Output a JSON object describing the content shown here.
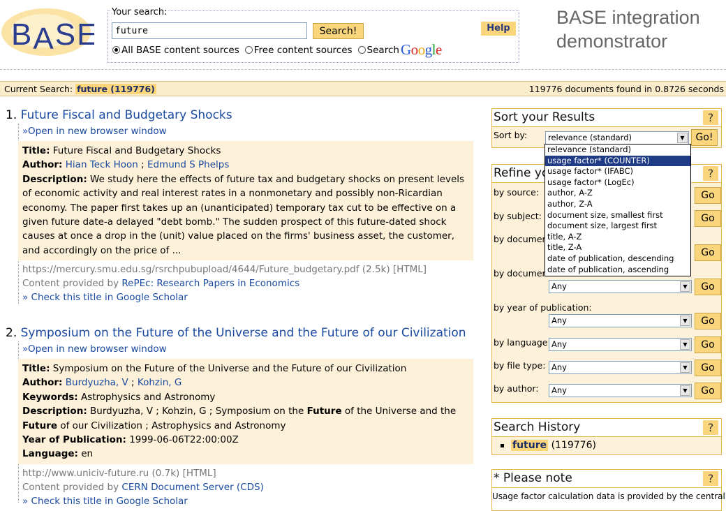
{
  "header": {
    "logo_text": "BASE",
    "search_label": "Your search:",
    "query": "future",
    "search_button": "Search!",
    "help_button": "Help",
    "radio_options": [
      {
        "label": "All BASE content sources",
        "selected": true
      },
      {
        "label": "Free content sources",
        "selected": false
      },
      {
        "label": "Search",
        "selected": false
      }
    ],
    "google_logo": "Google",
    "demo_title_line1": "BASE integration",
    "demo_title_line2": "demonstrator"
  },
  "status": {
    "current_label": "Current Search:",
    "current_query": "future (119776)",
    "summary": "119776 documents found in 0.8726 seconds"
  },
  "results": [
    {
      "number": "1.",
      "title": "Future Fiscal and Budgetary Shocks",
      "open_link": "»Open in new browser window",
      "title_label": "Title:",
      "title_value": "Future Fiscal and Budgetary Shocks",
      "author_label": "Author:",
      "authors": [
        "Hian Teck Hoon",
        "Edmund S Phelps"
      ],
      "description_label": "Description:",
      "description": "We study here the effects of future tax and budgetary shocks on present levels of economic activity and real interest rates in a nonmonetary and possibly non-Ricardian economy. The paper first takes up an (unanticipated) temporary tax cut to be effective on a given future date-a delayed \"debt bomb.\" The sudden prospect of this future-dated shock causes at once a drop in the (unit) value placed on the firms' business asset, the customer, and accordingly on the price of ...",
      "url": "https://mercury.smu.edu.sg/rsrchpubupload/4644/Future_budgetary.pdf (2.5k) [HTML]",
      "provided_label": "Content provided by",
      "provider": "RePEc: Research Papers in Economics",
      "scholar": "» Check this title in Google Scholar"
    },
    {
      "number": "2.",
      "title": "Symposium on the Future of the Universe and the Future of our Civilization",
      "open_link": "»Open in new browser window",
      "title_label": "Title:",
      "title_value": "Symposium on the Future of the Universe and the Future of our Civilization",
      "author_label": "Author:",
      "authors": [
        "Burdyuzha, V",
        "Kohzin, G"
      ],
      "keywords_label": "Keywords:",
      "keywords": "Astrophysics and Astronomy",
      "description_label": "Description:",
      "desc_parts": [
        "Burdyuzha, V ; Kohzin, G ; Symposium on the ",
        "Future",
        " of the Universe and the ",
        "Future",
        " of our Civilization ; Astrophysics and Astronomy"
      ],
      "year_label": "Year of Publication:",
      "year": "1999-06-06T22:00:00Z",
      "language_label": "Language:",
      "language": "en",
      "url": "http://www.uniciv-future.ru (0.7k) [HTML]",
      "provided_label": "Content provided by",
      "provider": "CERN Document Server (CDS)",
      "scholar": "» Check this title in Google Scholar"
    }
  ],
  "sort_panel": {
    "title": "Sort your Results",
    "help": "?",
    "sort_by_label": "Sort by:",
    "selected": "relevance (standard)",
    "go": "Go!",
    "options": [
      "relevance (standard)",
      "usage factor* (COUNTER)",
      "usage factor* (IFABC)",
      "usage factor* (LogEc)",
      "author, A-Z",
      "author, Z-A",
      "document size, smallest first",
      "document size, largest first",
      "title, A-Z",
      "title, Z-A",
      "date of publication, descending",
      "date of publication, ascending"
    ],
    "highlighted_index": 1
  },
  "refine_panel": {
    "title": "Refine yo",
    "help": "?",
    "rows": [
      {
        "label": "by source:",
        "value": "",
        "go": "Go"
      },
      {
        "label": "by subject:",
        "value": "",
        "go": "Go"
      },
      {
        "label": "by documen",
        "value": "",
        "go": "Go"
      },
      {
        "label": "by documen",
        "value": "Any",
        "go": "Go"
      },
      {
        "label": "by year of publication:",
        "value": "Any",
        "go": "Go"
      },
      {
        "label": "by language:",
        "value": "Any",
        "go": "Go"
      },
      {
        "label": "by file type:",
        "value": "Any",
        "go": "Go"
      },
      {
        "label": "by author:",
        "value": "Any",
        "go": "Go"
      }
    ]
  },
  "history_panel": {
    "title": "Search History",
    "help": "?",
    "item_query": "future",
    "item_count": "(119776)"
  },
  "note_panel": {
    "title": "* Please note",
    "help": "?",
    "text": "Usage factor calculation data is provided by the central"
  }
}
